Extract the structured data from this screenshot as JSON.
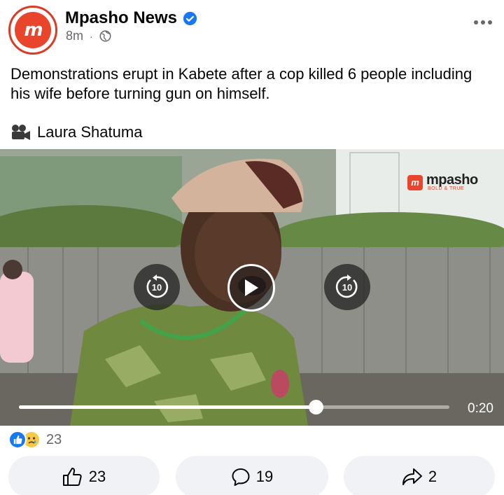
{
  "post": {
    "page_name": "Mpasho News",
    "avatar_letter": "m",
    "time_ago": "8m",
    "separator": "·",
    "privacy_icon": "globe-icon",
    "text": "Demonstrations erupt in Kabete after a cop killed 6 people including his wife before turning gun on himself.",
    "credit_icon": "video-camera-icon",
    "credit_name": "Laura Shatuma"
  },
  "video": {
    "watermark_name": "mpasho",
    "watermark_tagline": "BOLD & TRUE",
    "rewind_label": "10",
    "forward_label": "10",
    "elapsed_time": "0:20",
    "progress": 0.69
  },
  "engagement": {
    "reaction_icons": [
      "like-icon",
      "sad-icon"
    ],
    "reaction_count": "23",
    "like_count": "23",
    "comment_count": "19",
    "share_count": "2"
  },
  "colors": {
    "brand_red": "#e8452c",
    "facebook_blue": "#1877f2",
    "secondary_text": "#65676b",
    "button_bg": "#f0f2f5"
  }
}
